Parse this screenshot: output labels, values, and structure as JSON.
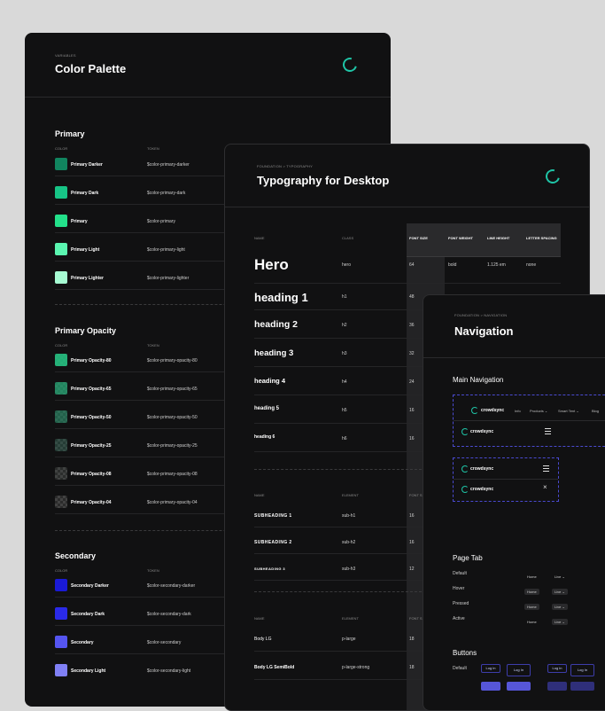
{
  "palette": {
    "crumb": "VARIABLES",
    "title": "Color Palette",
    "primary": {
      "heading": "Primary",
      "col_color": "COLOR",
      "col_token": "TOKEN",
      "rows": [
        {
          "label": "Primary Darker",
          "token": "$color-primary-darker",
          "color": "#11855f"
        },
        {
          "label": "Primary Dark",
          "token": "$color-primary-dark",
          "color": "#17c486"
        },
        {
          "label": "Primary",
          "token": "$color-primary",
          "color": "#23e08a"
        },
        {
          "label": "Primary Light",
          "token": "$color-primary-light",
          "color": "#5af5b0"
        },
        {
          "label": "Primary Lighter",
          "token": "$color-primary-lighter",
          "color": "#a6fbd3"
        }
      ]
    },
    "opacity": {
      "heading": "Primary Opacity",
      "col_color": "COLOR",
      "col_token": "TOKEN",
      "rows": [
        {
          "label": "Primary Opacity-80",
          "token": "$color-primary-opacity-80",
          "color": "#22c784"
        },
        {
          "label": "Primary Opacity-65",
          "token": "$color-primary-opacity-65",
          "color": "#1fa975"
        },
        {
          "label": "Primary Opacity-50",
          "token": "$color-primary-opacity-50",
          "color": "#1b8c64"
        },
        {
          "label": "Primary Opacity-25",
          "token": "$color-primary-opacity-25",
          "color": "#1a5d47"
        },
        {
          "label": "Primary Opacity-08",
          "token": "$color-primary-opacity-08",
          "color": "#2e3d37"
        },
        {
          "label": "Primary Opacity-04",
          "token": "$color-primary-opacity-04",
          "color": "#333937"
        }
      ]
    },
    "secondary": {
      "heading": "Secondary",
      "col_color": "COLOR",
      "col_token": "TOKEN",
      "rows": [
        {
          "label": "Secondary Darker",
          "token": "$color-secondary-darker",
          "color": "#1a1ad6"
        },
        {
          "label": "Secondary Dark",
          "token": "$color-secondary-dark",
          "color": "#2a2ae8"
        },
        {
          "label": "Secondary",
          "token": "$color-secondary",
          "color": "#5555f0"
        },
        {
          "label": "Secondary Light",
          "token": "$color-secondary-light",
          "color": "#8080f5"
        }
      ]
    }
  },
  "typography": {
    "crumb": "FOUNDATION > TYPOGRAPHY",
    "title": "Typography for Desktop",
    "head_name": "NAME",
    "head_class": "CLASS",
    "head_font_size": "FONT SIZE",
    "head_font_weight": "FONT WEIGHT",
    "head_line_height": "LINE HEIGHT",
    "head_letter_spacing": "LETTER SPACING",
    "hero": {
      "name": "Hero",
      "cls": "hero",
      "size": "64",
      "weight": "bold",
      "lh": "1.125 em",
      "ls": "none"
    },
    "headings": [
      {
        "name": "heading 1",
        "cls": "h1",
        "size": "48"
      },
      {
        "name": "heading 2",
        "cls": "h2",
        "size": "36"
      },
      {
        "name": "heading 3",
        "cls": "h3",
        "size": "32"
      },
      {
        "name": "heading 4",
        "cls": "h4",
        "size": "24"
      },
      {
        "name": "heading 5",
        "cls": "h5",
        "size": "16"
      },
      {
        "name": "heading 6",
        "cls": "h6",
        "size": "16"
      }
    ],
    "sub_head_name": "NAME",
    "sub_head_element": "ELEMENT",
    "sub_head_font": "FONT S",
    "subheadings": [
      {
        "name": "SUBHEADING 1",
        "cls": "sub-h1",
        "size": "16"
      },
      {
        "name": "SUBHEADING 2",
        "cls": "sub-h2",
        "size": "16"
      },
      {
        "name": "SUBHEADING 3",
        "cls": "sub-h3",
        "size": "12"
      }
    ],
    "body_head_name": "NAME",
    "body_head_element": "ELEMENT",
    "body_head_font": "FONT S",
    "body": [
      {
        "name": "Body LG",
        "cls": "p-large",
        "size": "18"
      },
      {
        "name": "Body LG SemiBold",
        "cls": "p-large-strong",
        "size": "18"
      }
    ]
  },
  "navigation": {
    "crumb": "FOUNDATION > NAVIGATION",
    "title": "Navigation",
    "main_nav": "Main Navigation",
    "brand": "crowdsync",
    "links": [
      "Info",
      "Products ⌄",
      "Smart Tent ⌄",
      "Blog"
    ],
    "page_tab": "Page Tab",
    "states": [
      "Default",
      "Hover",
      "Pressed",
      "Active"
    ],
    "tab_home": "Home",
    "tab_live": "Live ⌄",
    "buttons": "Buttons",
    "btn_default": "Default",
    "btn_login": "Log in",
    "btn_login2": "Log In"
  }
}
